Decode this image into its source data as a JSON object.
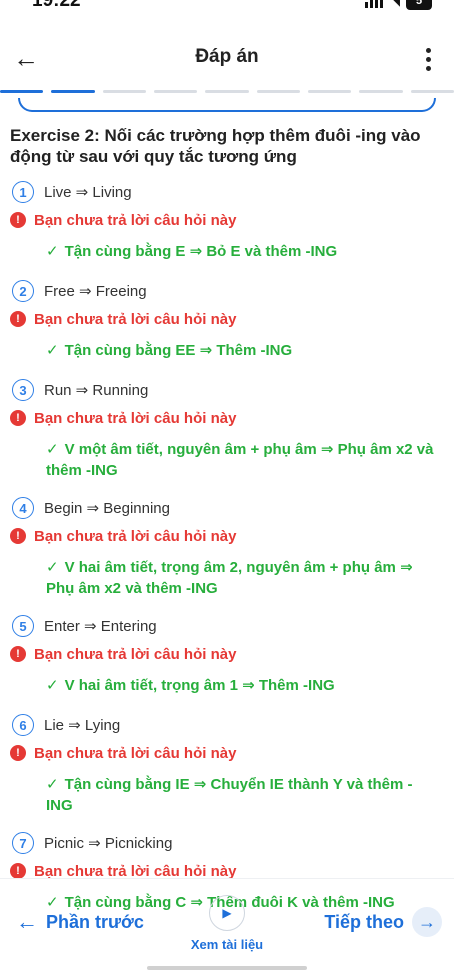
{
  "status": {
    "time": "19:22",
    "battery": "5"
  },
  "header": {
    "title": "Đáp án"
  },
  "exercise": {
    "title": "Exercise 2: Nối các trường hợp thêm đuôi -ing vào động từ sau với quy tắc tương ứng"
  },
  "questions": [
    {
      "number": "1",
      "text": "Live ⇒ Living",
      "warning": "Bạn chưa trả lời câu hỏi này",
      "answer": "Tận cùng bằng E ⇒ Bỏ E và thêm -ING"
    },
    {
      "number": "2",
      "text": "Free ⇒ Freeing",
      "warning": "Bạn chưa trả lời câu hỏi này",
      "answer": "Tận cùng bằng EE ⇒ Thêm -ING"
    },
    {
      "number": "3",
      "text": "Run ⇒ Running",
      "warning": "Bạn chưa trả lời câu hỏi này",
      "answer": "V một âm tiết, nguyên âm + phụ âm ⇒ Phụ âm x2 và thêm -ING"
    },
    {
      "number": "4",
      "text": "Begin ⇒ Beginning",
      "warning": "Bạn chưa trả lời câu hỏi này",
      "answer": "V hai âm tiết, trọng âm 2, nguyên âm + phụ âm ⇒ Phụ âm x2 và thêm -ING"
    },
    {
      "number": "5",
      "text": "Enter ⇒ Entering",
      "warning": "Bạn chưa trả lời câu hỏi này",
      "answer": "V hai âm tiết, trọng âm 1 ⇒ Thêm -ING"
    },
    {
      "number": "6",
      "text": "Lie ⇒ Lying",
      "warning": "Bạn chưa trả lời câu hỏi này",
      "answer": "Tận cùng bằng IE ⇒ Chuyển IE thành Y và thêm -ING"
    },
    {
      "number": "7",
      "text": "Picnic ⇒ Picnicking",
      "warning": "Bạn chưa trả lời câu hỏi này",
      "answer": "Tận cùng bằng C ⇒ Thêm đuôi K và thêm -ING"
    }
  ],
  "footer": {
    "prev_label": "Phần trước",
    "doc_label": "Xem tài liệu",
    "next_label": "Tiếp theo"
  },
  "colors": {
    "accent": "#1e6fd9",
    "error": "#e53935",
    "correct": "#27ae3c"
  },
  "icons": {
    "back": "arrow-left-icon",
    "more": "more-vertical-icon",
    "warning": "exclamation-icon",
    "check": "check-icon",
    "play": "play-icon",
    "next": "arrow-right-icon"
  }
}
